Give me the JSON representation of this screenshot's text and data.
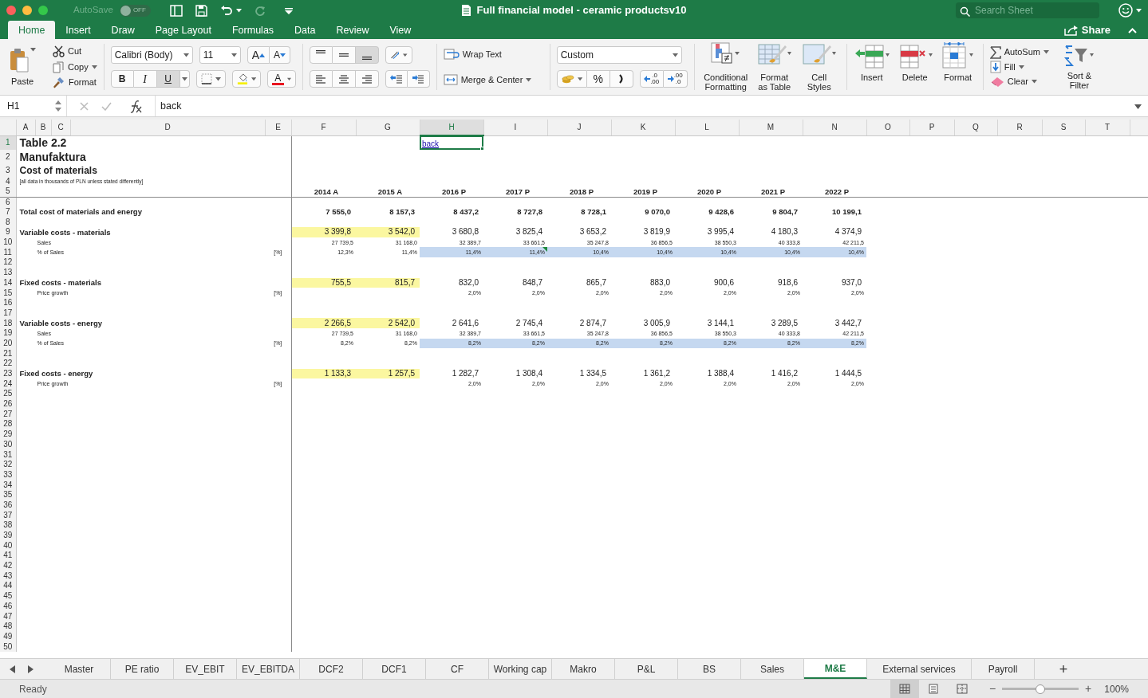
{
  "titlebar": {
    "autosave": {
      "label": "AutoSave",
      "on": false,
      "state_text": "OFF"
    },
    "title": "Full financial model - ceramic productsv10",
    "search": {
      "placeholder": "Search Sheet"
    }
  },
  "tabs": [
    {
      "label": "Home",
      "selected": true
    },
    {
      "label": "Insert",
      "selected": false
    },
    {
      "label": "Draw",
      "selected": false
    },
    {
      "label": "Page Layout",
      "selected": false
    },
    {
      "label": "Formulas",
      "selected": false
    },
    {
      "label": "Data",
      "selected": false
    },
    {
      "label": "Review",
      "selected": false
    },
    {
      "label": "View",
      "selected": false
    }
  ],
  "share": "Share",
  "ribbon": {
    "paste": "Paste",
    "clipboard": [
      "Cut",
      "Copy",
      "Format"
    ],
    "font": "Calibri (Body)",
    "size": "11",
    "grow_letters": [
      "A",
      "A"
    ],
    "font_styles": [
      {
        "label": "B",
        "pressed": false
      },
      {
        "label": "I",
        "pressed": false
      },
      {
        "label": "U",
        "pressed": true
      }
    ],
    "font_color_letter": "A",
    "vertical_align": [
      {
        "selected": false
      },
      {
        "selected": false
      },
      {
        "selected": true
      }
    ],
    "wrap": "Wrap Text",
    "merge": "Merge & Center",
    "number_format": "Custom",
    "percent": "%",
    "decimals": [
      {
        "top": ".0",
        "bottom": ".00"
      },
      {
        "top": ".00",
        "bottom": ".0"
      }
    ],
    "styles": [
      {
        "lines": [
          "Conditional",
          "Formatting"
        ]
      },
      {
        "lines": [
          "Format",
          "as Table"
        ]
      },
      {
        "lines": [
          "Cell",
          "Styles"
        ]
      }
    ],
    "cells": [
      "Insert",
      "Delete",
      "Format"
    ],
    "editing": [
      "AutoSum",
      "Fill",
      "Clear"
    ],
    "sort": {
      "lines": [
        "Sort &",
        "Filter"
      ]
    }
  },
  "formula_bar": {
    "name_box": "H1",
    "formula": "back"
  },
  "sheet": {
    "columns": [
      "A",
      "B",
      "C",
      "D",
      "E",
      "F",
      "G",
      "H",
      "I",
      "J",
      "K",
      "L",
      "M",
      "N",
      "O",
      "P",
      "Q",
      "R",
      "S",
      "T"
    ],
    "rows": [
      {
        "num": "1",
        "kind": "title",
        "label": "Table 2.2",
        "link": {
          "text": "back",
          "selected": true
        }
      },
      {
        "num": "2",
        "kind": "title",
        "label": "Manufaktura"
      },
      {
        "num": "3",
        "kind": "subtitle",
        "label": "Cost of materials"
      },
      {
        "num": "4",
        "kind": "note",
        "label": "[all data in thousands of PLN unless stated differently]"
      },
      {
        "num": "5",
        "kind": "years",
        "values": [
          "2014 A",
          "2015 A",
          "2016 P",
          "2017 P",
          "2018 P",
          "2019 P",
          "2020 P",
          "2021 P",
          "2022 P"
        ]
      },
      {
        "num": "6",
        "kind": "blank"
      },
      {
        "num": "7",
        "kind": "total",
        "label": "Total cost of materials and energy",
        "values": [
          "7 555,0",
          "8 157,3",
          "8 437,2",
          "8 727,8",
          "8 728,1",
          "9 070,0",
          "9 428,6",
          "9 804,7",
          "10 199,1"
        ]
      },
      {
        "num": "8",
        "kind": "blank"
      },
      {
        "num": "9",
        "kind": "section",
        "label": "Variable costs - materials",
        "actuals_highlighted": true,
        "values": [
          "3 399,8",
          "3 542,0",
          "3 680,8",
          "3 825,4",
          "3 653,2",
          "3 819,9",
          "3 995,4",
          "4 180,3",
          "4 374,9"
        ]
      },
      {
        "num": "10",
        "kind": "detail",
        "label": "Sales",
        "values": [
          "27 739,5",
          "31 168,0",
          "32 389,7",
          "33 661,5",
          "35 247,8",
          "36 856,5",
          "38 550,3",
          "40 333,8",
          "42 211,5"
        ]
      },
      {
        "num": "11",
        "kind": "detail",
        "label": "% of Sales",
        "unit": "[%]",
        "forecast_highlighted": true,
        "values": [
          "12,3%",
          "11,4%",
          "11,4%",
          "11,4%",
          "10,4%",
          "10,4%",
          "10,4%",
          "10,4%",
          "10,4%"
        ],
        "flags": [
          false,
          false,
          false,
          true,
          false,
          false,
          false,
          false,
          false
        ]
      },
      {
        "num": "12",
        "kind": "blank"
      },
      {
        "num": "13",
        "kind": "blank"
      },
      {
        "num": "14",
        "kind": "section",
        "label": "Fixed costs - materials",
        "actuals_highlighted": true,
        "values": [
          "755,5",
          "815,7",
          "832,0",
          "848,7",
          "865,7",
          "883,0",
          "900,6",
          "918,6",
          "937,0"
        ]
      },
      {
        "num": "15",
        "kind": "growth",
        "label": "Price growth",
        "unit": "[%]",
        "values": [
          "2,0%",
          "2,0%",
          "2,0%",
          "2,0%",
          "2,0%",
          "2,0%",
          "2,0%"
        ]
      },
      {
        "num": "16",
        "kind": "blank"
      },
      {
        "num": "17",
        "kind": "blank"
      },
      {
        "num": "18",
        "kind": "section",
        "label": "Variable costs - energy",
        "actuals_highlighted": true,
        "values": [
          "2 266,5",
          "2 542,0",
          "2 641,6",
          "2 745,4",
          "2 874,7",
          "3 005,9",
          "3 144,1",
          "3 289,5",
          "3 442,7"
        ]
      },
      {
        "num": "19",
        "kind": "detail",
        "label": "Sales",
        "values": [
          "27 739,5",
          "31 168,0",
          "32 389,7",
          "33 661,5",
          "35 247,8",
          "36 856,5",
          "38 550,3",
          "40 333,8",
          "42 211,5"
        ]
      },
      {
        "num": "20",
        "kind": "detail",
        "label": "% of Sales",
        "unit": "[%]",
        "forecast_highlighted": true,
        "values": [
          "8,2%",
          "8,2%",
          "8,2%",
          "8,2%",
          "8,2%",
          "8,2%",
          "8,2%",
          "8,2%",
          "8,2%"
        ]
      },
      {
        "num": "21",
        "kind": "blank"
      },
      {
        "num": "22",
        "kind": "blank"
      },
      {
        "num": "23",
        "kind": "section",
        "label": "Fixed costs - energy",
        "actuals_highlighted": true,
        "values": [
          "1 133,3",
          "1 257,5",
          "1 282,7",
          "1 308,4",
          "1 334,5",
          "1 361,2",
          "1 388,4",
          "1 416,2",
          "1 444,5"
        ]
      },
      {
        "num": "24",
        "kind": "growth",
        "label": "Price growth",
        "unit": "[%]",
        "values": [
          "2,0%",
          "2,0%",
          "2,0%",
          "2,0%",
          "2,0%",
          "2,0%",
          "2,0%"
        ]
      },
      {
        "num": "25",
        "kind": "blank"
      },
      {
        "num": "26",
        "kind": "blank"
      },
      {
        "num": "27",
        "kind": "blank"
      },
      {
        "num": "28",
        "kind": "blank"
      },
      {
        "num": "29",
        "kind": "blank"
      },
      {
        "num": "30",
        "kind": "blank"
      },
      {
        "num": "31",
        "kind": "blank"
      },
      {
        "num": "32",
        "kind": "blank"
      },
      {
        "num": "33",
        "kind": "blank"
      },
      {
        "num": "34",
        "kind": "blank"
      },
      {
        "num": "35",
        "kind": "blank"
      },
      {
        "num": "36",
        "kind": "blank"
      },
      {
        "num": "37",
        "kind": "blank"
      },
      {
        "num": "38",
        "kind": "blank"
      },
      {
        "num": "39",
        "kind": "blank"
      },
      {
        "num": "40",
        "kind": "blank"
      },
      {
        "num": "41",
        "kind": "blank"
      },
      {
        "num": "42",
        "kind": "blank"
      },
      {
        "num": "43",
        "kind": "blank"
      },
      {
        "num": "44",
        "kind": "blank"
      },
      {
        "num": "45",
        "kind": "blank"
      },
      {
        "num": "46",
        "kind": "blank"
      },
      {
        "num": "47",
        "kind": "blank"
      },
      {
        "num": "48",
        "kind": "blank"
      },
      {
        "num": "49",
        "kind": "blank"
      },
      {
        "num": "50",
        "kind": "blank"
      }
    ]
  },
  "sheet_tabs": [
    {
      "label": "Master",
      "selected": false
    },
    {
      "label": "PE ratio",
      "selected": false
    },
    {
      "label": "EV_EBIT",
      "selected": false
    },
    {
      "label": "EV_EBITDA",
      "selected": false
    },
    {
      "label": "DCF2",
      "selected": false
    },
    {
      "label": "DCF1",
      "selected": false
    },
    {
      "label": "CF",
      "selected": false
    },
    {
      "label": "Working cap",
      "selected": false
    },
    {
      "label": "Makro",
      "selected": false
    },
    {
      "label": "P&L",
      "selected": false
    },
    {
      "label": "BS",
      "selected": false
    },
    {
      "label": "Sales",
      "selected": false
    },
    {
      "label": "M&E",
      "selected": true
    },
    {
      "label": "External services",
      "selected": false
    },
    {
      "label": "Payroll",
      "selected": false
    }
  ],
  "add_sheet": "+",
  "status_bar": {
    "status": "Ready",
    "views": [
      {
        "selected": true
      },
      {
        "selected": false
      },
      {
        "selected": false
      }
    ],
    "zoom": {
      "level": 0.5,
      "reading": "100%"
    },
    "zoom_out": "−",
    "zoom_in": "+"
  }
}
